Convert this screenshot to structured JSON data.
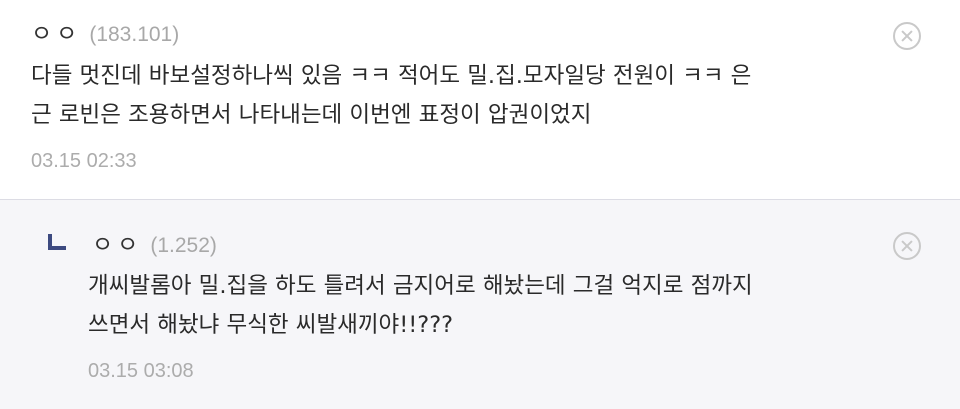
{
  "comments": [
    {
      "author": "ㅇㅇ",
      "ip": "(183.101)",
      "lines": [
        "다들 멋진데 바보설정하나씩 있음 ㅋㅋ 적어도 밀.집.모자일당 전원이 ㅋㅋ 은",
        "근 로빈은 조용하면서 나타내는데 이번엔 표정이 압권이었지"
      ],
      "time": "03.15 02:33"
    }
  ],
  "replies": [
    {
      "author": "ㅇㅇ",
      "ip": "(1.252)",
      "lines": [
        "개씨발롬아 밀.집을 하도 틀려서 금지어로 해놨는데 그걸 억지로 점까지",
        "쓰면서 해놨냐 무식한 씨발새끼야!!???"
      ],
      "time": "03.15 03:08"
    }
  ],
  "icons": {
    "delete": "close-circle-icon",
    "reply": "reply-arrow-icon"
  },
  "colors": {
    "reply_background": "#f6f6f9",
    "reply_marker": "#3d4a80",
    "meta_text": "#a8a8a8"
  }
}
